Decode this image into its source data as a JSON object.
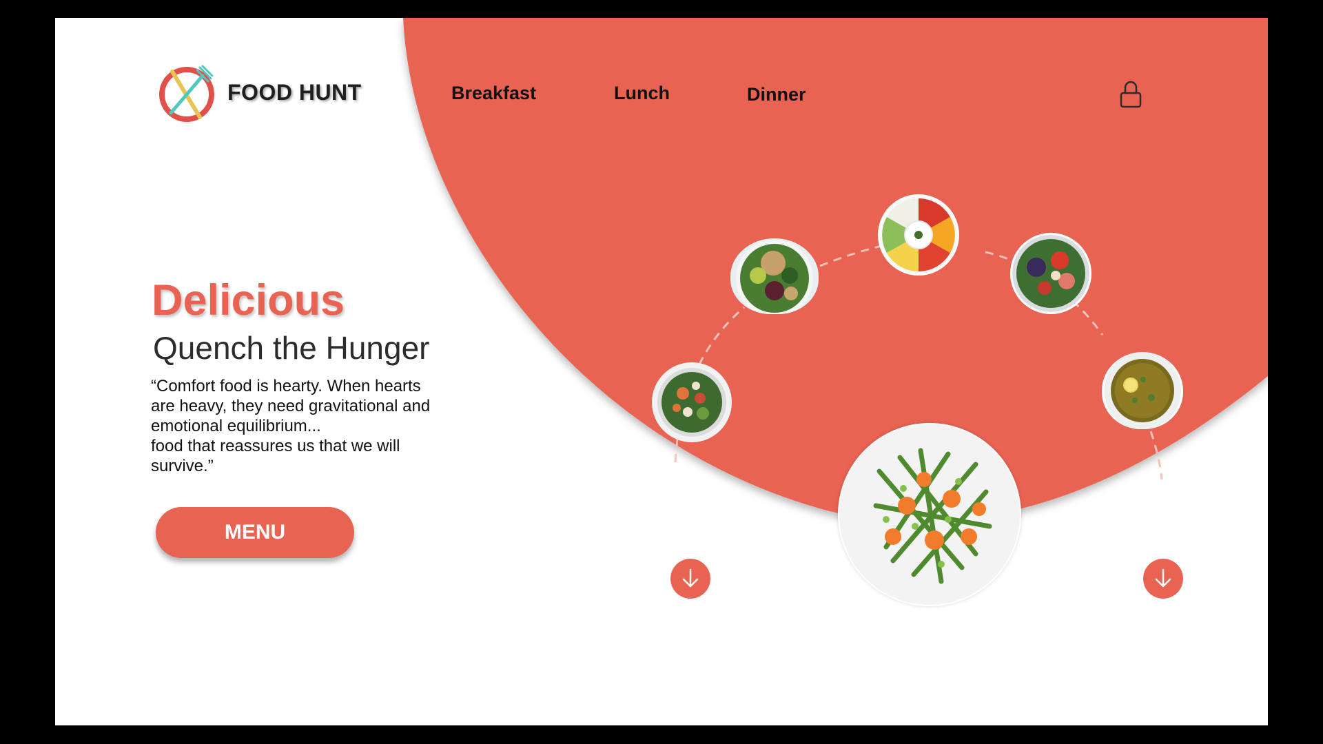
{
  "brand": {
    "name": "FOOD HUNT",
    "logo_icon": "fork-knife-circle-icon"
  },
  "nav": {
    "items": [
      {
        "label": "Breakfast"
      },
      {
        "label": "Lunch"
      },
      {
        "label": "Dinner"
      }
    ]
  },
  "header": {
    "lock_icon": "lock-icon"
  },
  "hero": {
    "title": "Delicious",
    "subtitle": "Quench the Hunger",
    "quote_lines": [
      "“Comfort food is hearty. When hearts",
      "are heavy, they need gravitational and",
      "emotional equilibrium...",
      "food that reassures us that we will",
      "survive.”"
    ],
    "menu_label": "MENU"
  },
  "carousel": {
    "dishes": [
      "salad-bowl-1",
      "grain-salad-bowl",
      "veggie-dip-platter",
      "berry-salad-bowl",
      "lentil-soup-bowl",
      "green-beans-carrots-plate"
    ],
    "arrow_icon": "arrow-down-icon"
  },
  "colors": {
    "accent": "#e96352",
    "text": "#111111",
    "background": "#ffffff",
    "frame": "#000000"
  }
}
